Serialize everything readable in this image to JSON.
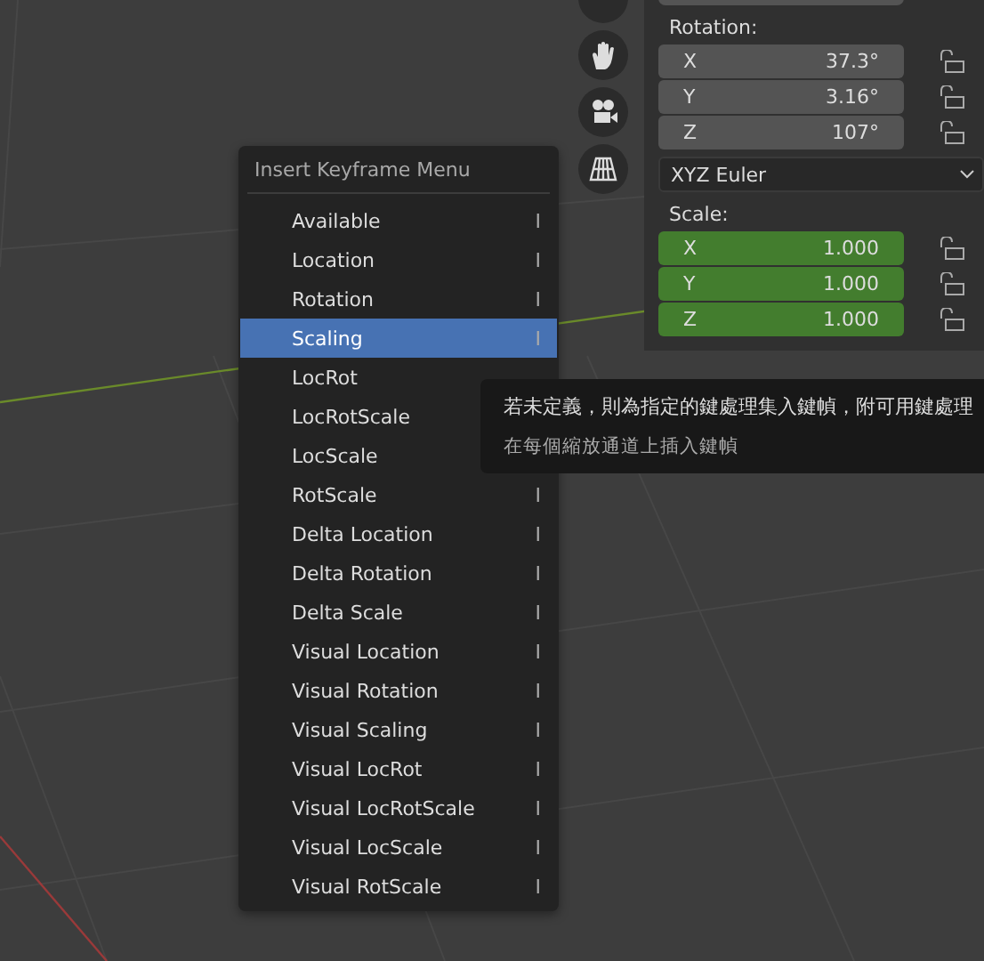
{
  "side_tools": [
    {
      "kind": "partial"
    },
    {
      "kind": "hand"
    },
    {
      "kind": "camera"
    },
    {
      "kind": "grid"
    }
  ],
  "properties": {
    "rotation": {
      "label": "Rotation:",
      "fields": [
        {
          "axis": "X",
          "value": "37.3°",
          "locked": false
        },
        {
          "axis": "Y",
          "value": "3.16°",
          "locked": false
        },
        {
          "axis": "Z",
          "value": "107°",
          "locked": false
        }
      ]
    },
    "rotation_mode": "XYZ Euler",
    "scale": {
      "label": "Scale:",
      "keyed": true,
      "fields": [
        {
          "axis": "X",
          "value": "1.000",
          "locked": false
        },
        {
          "axis": "Y",
          "value": "1.000",
          "locked": false
        },
        {
          "axis": "Z",
          "value": "1.000",
          "locked": false
        }
      ]
    }
  },
  "menu": {
    "title": "Insert Keyframe Menu",
    "items": [
      {
        "label": "Available",
        "shortcut": "I",
        "selected": false
      },
      {
        "label": "Location",
        "shortcut": "I",
        "selected": false
      },
      {
        "label": "Rotation",
        "shortcut": "I",
        "selected": false
      },
      {
        "label": "Scaling",
        "shortcut": "I",
        "selected": true
      },
      {
        "label": "LocRot",
        "selected": false
      },
      {
        "label": "LocRotScale",
        "selected": false
      },
      {
        "label": "LocScale",
        "selected": false
      },
      {
        "label": "RotScale",
        "shortcut": "I",
        "selected": false
      },
      {
        "label": "Delta Location",
        "shortcut": "I",
        "selected": false
      },
      {
        "label": "Delta Rotation",
        "shortcut": "I",
        "selected": false
      },
      {
        "label": "Delta Scale",
        "shortcut": "I",
        "selected": false
      },
      {
        "label": "Visual Location",
        "shortcut": "I",
        "selected": false
      },
      {
        "label": "Visual Rotation",
        "shortcut": "I",
        "selected": false
      },
      {
        "label": "Visual Scaling",
        "shortcut": "I",
        "selected": false
      },
      {
        "label": "Visual LocRot",
        "shortcut": "I",
        "selected": false
      },
      {
        "label": "Visual LocRotScale",
        "shortcut": "I",
        "selected": false
      },
      {
        "label": "Visual LocScale",
        "shortcut": "I",
        "selected": false
      },
      {
        "label": "Visual RotScale",
        "shortcut": "I",
        "selected": false
      }
    ]
  },
  "tooltip": {
    "description": "若未定義，則為指定的鍵處理集入鍵幀，附可用鍵處理",
    "detail": "在每個縮放通道上插入鍵幀"
  }
}
